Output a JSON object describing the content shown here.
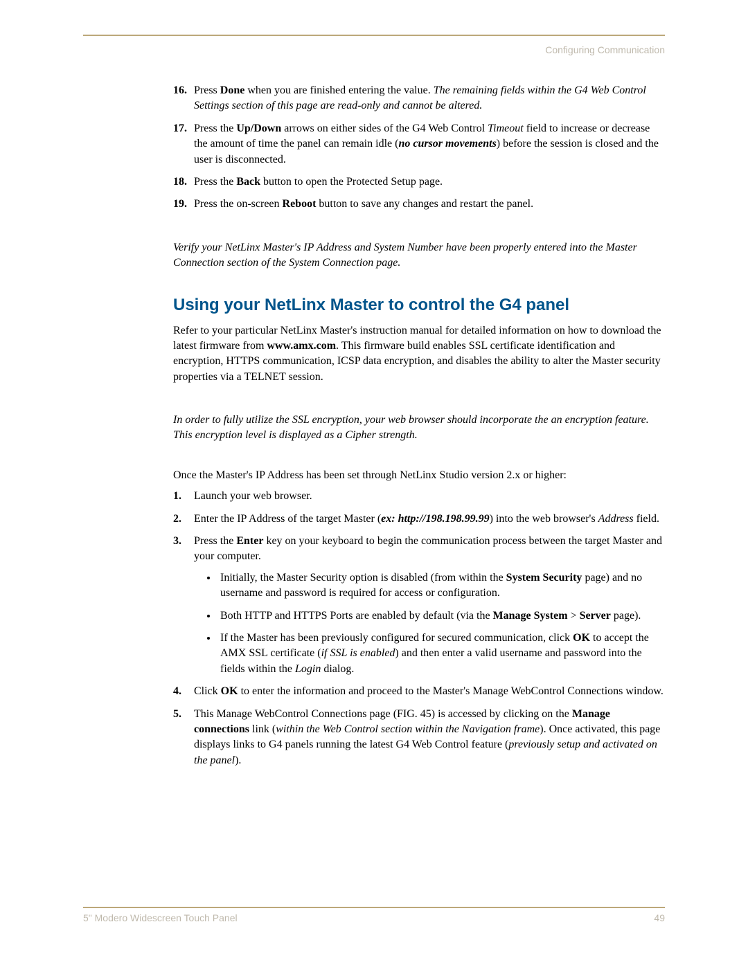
{
  "header": {
    "section_label": "Configuring Communication"
  },
  "steps_a": {
    "items": [
      {
        "num": "16.",
        "pre": "Press ",
        "bold1": "Done",
        "mid": " when you are finished entering the value. ",
        "tail_italic": "The remaining fields within the G4 Web Control Settings section of this page are read-only and cannot be altered."
      },
      {
        "num": "17.",
        "text": "Press the ",
        "bold1": "Up/Down",
        "mid1": " arrows on either sides of the G4 Web Control ",
        "ital1": "Timeout",
        "mid2": " field to increase or decrease the amount of time the panel can remain idle (",
        "bi1": "no cursor movements",
        "mid3": ") before the session is closed and the user is disconnected."
      },
      {
        "num": "18.",
        "text": "Press the ",
        "bold1": "Back",
        "tail": " button to open the Protected Setup page."
      },
      {
        "num": "19.",
        "text": "Press the on-screen ",
        "bold1": "Reboot",
        "tail": " button to save any changes and restart the panel."
      }
    ]
  },
  "note1": "Verify your NetLinx Master's IP Address and System Number have been properly entered into the Master Connection section of the System Connection page.",
  "heading": "Using your NetLinx Master to control the G4 panel",
  "para1": {
    "p1": "Refer to your particular NetLinx Master's instruction manual for detailed information on how to download the latest firmware from ",
    "b1": "www.amx.com",
    "p2": ". This firmware build enables SSL certificate identification and encryption, HTTPS communication, ICSP data encryption, and disables the ability to alter the Master security properties via a TELNET session."
  },
  "note2": "In order to fully utilize the SSL encryption, your web browser should incorporate the an encryption feature. This encryption level is displayed as a Cipher strength.",
  "para2": "Once the Master's IP Address has been set through NetLinx Studio version 2.x or higher:",
  "steps_b": {
    "s1": {
      "num": "1.",
      "text": "Launch your web browser."
    },
    "s2": {
      "num": "2.",
      "p1": "Enter the IP Address of the target Master (",
      "bi1": "ex: http://198.198.99.99",
      "p2": ") into the web browser's ",
      "i1": "Address",
      "p3": " field."
    },
    "s3": {
      "num": "3.",
      "p1": "Press the ",
      "b1": "Enter",
      "p2": " key on your keyboard to begin the communication process between the target Master and your computer.",
      "bullets": [
        {
          "p1": "Initially, the Master Security option is disabled (from within the ",
          "b1": "System Security",
          "p2": " page) and no username and password is required for access or configuration."
        },
        {
          "p1": "Both HTTP and HTTPS Ports are enabled by default (via the ",
          "b1": "Manage System",
          "sep": " > ",
          "b2": "Server",
          "p2": " page)."
        },
        {
          "p1": "If the Master has been previously configured for secured communication, click ",
          "b1": "OK",
          "p2": " to accept the AMX SSL certificate (",
          "i1": "if SSL is enabled",
          "p3": ") and then enter a valid username and password into the fields within the ",
          "i2": "Login",
          "p4": " dialog."
        }
      ]
    },
    "s4": {
      "num": "4.",
      "p1": "Click ",
      "b1": "OK",
      "p2": " to enter the information and proceed to the Master's Manage WebControl Connections window."
    },
    "s5": {
      "num": "5.",
      "p1": "This Manage WebControl Connections page (FIG. 45) is accessed by clicking on the ",
      "b1": "Manage connections",
      "p2": " link (",
      "i1": "within the Web Control section within the Navigation frame",
      "p3": "). Once activated, this page displays links to G4 panels running the latest G4 Web Control feature (",
      "i2": "previously setup and activated on the panel",
      "p4": ")."
    }
  },
  "footer": {
    "left": "5\" Modero Widescreen Touch Panel",
    "right": "49"
  }
}
